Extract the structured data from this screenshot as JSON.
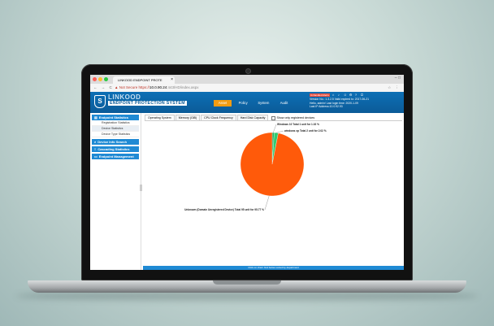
{
  "browser": {
    "tab_title": "LINKOOD ENDPOINT PROTE",
    "tab_close": "×",
    "window_controls": "– □",
    "nav_buttons": "← → C",
    "not_secure": "▲ Not Secure",
    "url_protocol": "https://",
    "url_host": "10.0.90.24",
    "url_path": ":443/HD/index.aspx",
    "addr_icons": "☆ ⋮"
  },
  "app": {
    "brand_name": "LINKOOD",
    "brand_sub": "ENDPOINT PROTECTION SYSTEM",
    "top_nav": [
      {
        "label": "Asset",
        "active": true
      },
      {
        "label": "Policy",
        "active": false
      },
      {
        "label": "System",
        "active": false
      },
      {
        "label": "Audit",
        "active": false
      }
    ],
    "info_lines": [
      "Version No.: 1.3.2.5   Valid expired to: 2017-06-21",
      "Hello, admin!  Last login time: 2020-1-09",
      "Last IP Address:10.0.92.93"
    ],
    "badge": "Unhandled Alerts"
  },
  "sidebar": [
    {
      "label": "Endpoint Statistics",
      "icon": "chart-icon",
      "items": [
        "Registration Statistics",
        "Device Statistics",
        "Device Type Statistics"
      ],
      "selected": 1
    },
    {
      "label": "Device Info Search",
      "icon": "search-icon",
      "items": []
    },
    {
      "label": "Cascading Statistics",
      "icon": "cascade-icon",
      "items": []
    },
    {
      "label": "Endpoint Management",
      "icon": "monitor-icon",
      "items": []
    }
  ],
  "content": {
    "tabs": [
      "Operating System",
      "Memory (GiB)",
      "CPU Clock Frequency",
      "Hard Disk Capacity"
    ],
    "checkbox_label": "Show only registered devices",
    "footer": "Click on chart: find below sorted by department"
  },
  "chart_data": {
    "type": "pie",
    "slices": [
      {
        "label": "Windows 10 Total 1 unit for 1.02 %",
        "value": 1.02,
        "color": "#27ae60"
      },
      {
        "label": "windows xp Total 2 unit for 2.02 %",
        "value": 2.02,
        "color": "#2ecc71"
      },
      {
        "label": "Unknown (Domain Unregistered Device) Total 95 unit for 95.77 %",
        "value": 95.77,
        "color": "#ff5a0a"
      }
    ]
  }
}
